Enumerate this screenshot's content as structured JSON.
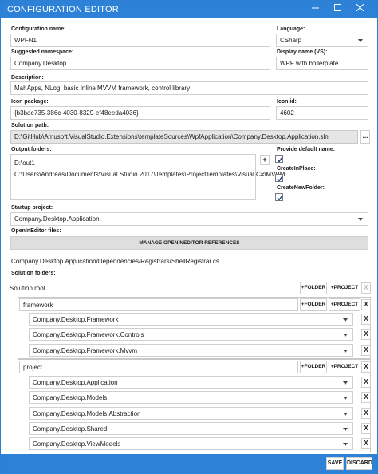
{
  "window": {
    "title": "CONFIGURATION EDITOR"
  },
  "form": {
    "configuration_name_label": "Configuration name:",
    "configuration_name": "WPFN1",
    "language_label": "Language:",
    "language": "CSharp",
    "suggested_namespace_label": "Suggested namespace:",
    "suggested_namespace": "Company.Desktop",
    "display_name_label": "Display name (VS):",
    "display_name": "WPF with boilerplate",
    "description_label": "Description:",
    "description": "MahApps, NLog, basic Inline MVVM framework, control library",
    "icon_package_label": "Icon package:",
    "icon_package": "{b3bae735-386c-4030-8329-ef48eeda4036}",
    "icon_id_label": "Icon id:",
    "icon_id": "4602",
    "solution_path_label": "Solution path:",
    "solution_path": "D:\\GitHub\\Amusoft.VisualStudio.Extensions\\templateSources\\WpfApplication\\Company.Desktop.Application.sln",
    "browse_label": "...",
    "output_folders_label": "Output folders:",
    "output_folders": [
      "D:\\out1",
      "C:\\Users\\Andreas\\Documents\\Visual Studio 2017\\Templates\\ProjectTemplates\\Visual C#\\MVVM"
    ],
    "add_output_label": "+",
    "provide_default_name_label": "Provide default name:",
    "create_in_place_label": "CreateInPlace:",
    "create_new_folder_label": "CreateNewFolder:",
    "startup_project_label": "Startup project:",
    "startup_project": "Company.Desktop.Application",
    "openineditor_files_label": "OpenInEditor files:",
    "manage_button": "MANAGE OPENINEDITOR REFERENCES",
    "openineditor_file": "Company.Desktop.Application/Dependencies/Registrars/ShellRegistrar.cs",
    "solution_folders_label": "Solution folders:"
  },
  "tree": {
    "root_label": "Solution root",
    "add_folder": "+FOLDER",
    "add_project": "+PROJECT",
    "remove": "X",
    "folders": [
      {
        "name": "framework",
        "projects": [
          "Company.Desktop.Framework",
          "Company.Desktop.Framework.Controls",
          "Company.Desktop.Framework.Mvvm"
        ]
      },
      {
        "name": "project",
        "projects": [
          "Company.Desktop.Application",
          "Company.Desktop.Models",
          "Company.Desktop.Models.Abstraction",
          "Company.Desktop.Shared",
          "Company.Desktop.ViewModels"
        ]
      }
    ]
  },
  "footer": {
    "save": "SAVE",
    "discard": "DISCARD"
  },
  "colors": {
    "accent": "#2d82d8"
  }
}
